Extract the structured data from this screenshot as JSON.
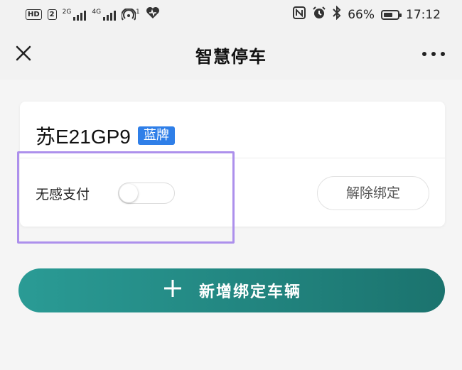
{
  "status_bar": {
    "hd_badge": "HD",
    "sim_number": "2",
    "network_1": "2G",
    "network_2": "4G",
    "hotspot_count": "1",
    "battery": "66%",
    "battery_level": 0.66,
    "time": "17:12",
    "icons": [
      "nfc-icon",
      "alarm-icon",
      "bluetooth-icon",
      "battery-icon",
      "heart-icon",
      "hotspot-icon"
    ]
  },
  "nav": {
    "title": "智慧停车",
    "close_icon": "close-icon",
    "more_icon": "more-icon"
  },
  "vehicle": {
    "plate": "苏E21GP9",
    "plate_color_label": "蓝牌",
    "plate_color": "#2f7fe8",
    "auto_pay_label": "无感支付",
    "auto_pay_enabled": false,
    "unbind_label": "解除绑定"
  },
  "add_vehicle": {
    "icon": "plus-icon",
    "label": "新增绑定车辆",
    "color": "#1f8580"
  }
}
